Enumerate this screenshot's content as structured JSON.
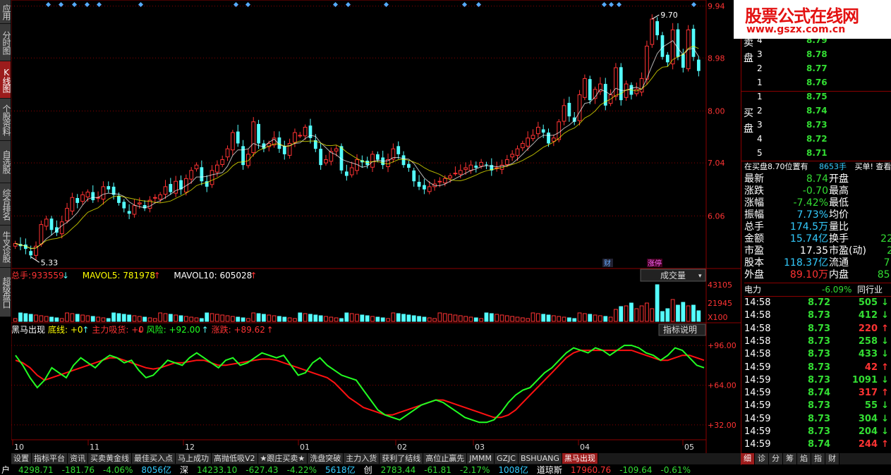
{
  "left_nav": [
    "应用",
    "分时图",
    "K线图",
    "个股资料",
    "自选股",
    "综合排名",
    "牛叉诊股",
    "超级盘口"
  ],
  "left_nav_active": 2,
  "price_axis": [
    "9.94",
    "8.98",
    "8.00",
    "7.04",
    "6.06"
  ],
  "price_annotations": {
    "high": "9.70",
    "low": "5.33"
  },
  "event_labels": {
    "fin": "财",
    "limit": "涨停"
  },
  "volume_header": {
    "total_label": "总手",
    "total_value": "933559",
    "ma5_label": "MAVOL5",
    "ma5_value": "781978",
    "ma10_label": "MAVOL10",
    "ma10_value": "605028",
    "selector": "成交量"
  },
  "volume_axis": [
    "43105",
    "21945"
  ],
  "volume_unit": "X100",
  "indicator_header": {
    "name": "黑马出现",
    "items": [
      {
        "label": "底线",
        "value": "+0"
      },
      {
        "label": "主力吸货",
        "value": "+0"
      },
      {
        "label": "风险",
        "value": "+92.00"
      },
      {
        "label": "涨跌",
        "value": "+89.62"
      }
    ],
    "explain_button": "指标说明"
  },
  "indicator_axis": [
    "+96.00",
    "+64.00",
    "+32.00"
  ],
  "date_axis": [
    "10",
    "11",
    "12",
    "01",
    "02",
    "03",
    "04",
    "05"
  ],
  "bottom_tabs": [
    "设置",
    "指标平台",
    "资讯",
    "买卖黄金线",
    "最佳买入点",
    "马上成功",
    "高抛低吸V2",
    "★跟庄买卖★",
    "洗盘突破",
    "主力入货",
    "获利了结线",
    "高位止赢先",
    "JMMM",
    "GZJC",
    "BSHUANG",
    "黑马出现"
  ],
  "bottom_tab_active": 15,
  "logo": {
    "title": "股票公式在线网",
    "url": "www.gszx.com.cn"
  },
  "order_book": {
    "sell_label": "卖盘",
    "buy_label": "买盘",
    "sell": [
      {
        "level": "4",
        "price": "8.79"
      },
      {
        "level": "3",
        "price": "8.78"
      },
      {
        "level": "2",
        "price": "8.77"
      },
      {
        "level": "1",
        "price": "8.76"
      }
    ],
    "buy": [
      {
        "level": "1",
        "price": "8.75"
      },
      {
        "level": "2",
        "price": "8.74"
      },
      {
        "level": "3",
        "price": "8.73"
      },
      {
        "level": "4",
        "price": "8.72"
      },
      {
        "level": "5",
        "price": "8.71"
      }
    ],
    "notice": "在买盘8.70位置有",
    "notice_value": "8653手",
    "notice_tail": "买单! 查看"
  },
  "quote": [
    {
      "l": "最新",
      "v": "8.74",
      "c": "#33dd33",
      "l2": "开盘",
      "v2": ""
    },
    {
      "l": "涨跌",
      "v": "-0.70",
      "c": "#33dd33",
      "l2": "最高",
      "v2": ""
    },
    {
      "l": "涨幅",
      "v": "-7.42%",
      "c": "#33dd33",
      "l2": "最低",
      "v2": ""
    },
    {
      "l": "振幅",
      "v": "7.73%",
      "c": "#33ccff",
      "l2": "均价",
      "v2": ""
    },
    {
      "l": "总手",
      "v": "174.5万",
      "c": "#33ccff",
      "l2": "量比",
      "v2": ""
    },
    {
      "l": "金额",
      "v": "15.74亿",
      "c": "#33ccff",
      "l2": "换手",
      "v2": "22"
    },
    {
      "l": "市盈",
      "v": "17.35",
      "c": "#ffffff",
      "l2": "市盈(动)",
      "v2": "2"
    },
    {
      "l": "股本",
      "v": "118.37亿",
      "c": "#33ccff",
      "l2": "流通",
      "v2": "7."
    },
    {
      "l": "外盘",
      "v": "89.10万",
      "c": "#ff3333",
      "l2": "内盘",
      "v2": "85."
    }
  ],
  "sector": {
    "name": "电力",
    "change": "-6.09%",
    "compare": "同行业"
  },
  "ticks": [
    {
      "time": "14:58",
      "price": "8.72",
      "vol": "505",
      "dir": "down"
    },
    {
      "time": "14:58",
      "price": "8.73",
      "vol": "412",
      "dir": "down"
    },
    {
      "time": "14:58",
      "price": "8.73",
      "vol": "220",
      "dir": "up"
    },
    {
      "time": "14:58",
      "price": "8.73",
      "vol": "258",
      "dir": "down"
    },
    {
      "time": "14:58",
      "price": "8.73",
      "vol": "433",
      "dir": "down"
    },
    {
      "time": "14:59",
      "price": "8.73",
      "vol": "42",
      "dir": "up"
    },
    {
      "time": "14:59",
      "price": "8.73",
      "vol": "1091",
      "dir": "down"
    },
    {
      "time": "14:59",
      "price": "8.74",
      "vol": "317",
      "dir": "up"
    },
    {
      "time": "14:59",
      "price": "8.73",
      "vol": "55",
      "dir": "down"
    },
    {
      "time": "14:59",
      "price": "8.73",
      "vol": "304",
      "dir": "down"
    },
    {
      "time": "14:59",
      "price": "8.73",
      "vol": "204",
      "dir": "down"
    },
    {
      "time": "14:59",
      "price": "8.74",
      "vol": "244",
      "dir": "up"
    }
  ],
  "right_tabs": [
    "细",
    "诊",
    "分",
    "筹",
    "焰",
    "指",
    "财"
  ],
  "right_tab_active": 0,
  "status_bar": [
    {
      "text": "户",
      "c": "#ffffff"
    },
    {
      "text": "4298.71",
      "c": "#33dd33"
    },
    {
      "text": "-181.76",
      "c": "#33dd33"
    },
    {
      "text": "-4.06%",
      "c": "#33dd33"
    },
    {
      "text": "8056亿",
      "c": "#33ccff"
    },
    {
      "text": "深",
      "c": "#ffffff"
    },
    {
      "text": "14233.10",
      "c": "#33dd33"
    },
    {
      "text": "-627.43",
      "c": "#33dd33"
    },
    {
      "text": "-4.22%",
      "c": "#33dd33"
    },
    {
      "text": "5618亿",
      "c": "#33ccff"
    },
    {
      "text": "创",
      "c": "#ffffff"
    },
    {
      "text": "2783.44",
      "c": "#33dd33"
    },
    {
      "text": "-61.81",
      "c": "#33dd33"
    },
    {
      "text": "-2.17%",
      "c": "#33dd33"
    },
    {
      "text": "1008亿",
      "c": "#33ccff"
    },
    {
      "text": "道琼斯",
      "c": "#ffffff"
    },
    {
      "text": "17960.76",
      "c": "#ff3333"
    },
    {
      "text": "-109.64",
      "c": "#33dd33"
    },
    {
      "text": "-0.61%",
      "c": "#33dd33"
    }
  ],
  "colors": {
    "up": "#ff3333",
    "down": "#54ffff",
    "ma_white": "#ffffff",
    "ma_yellow": "#ffff00",
    "grid": "#8b0000",
    "indicator_green": "#22ff22",
    "indicator_red": "#ff1111"
  },
  "chart_data": {
    "type": "candlestick",
    "price_range": [
      5.33,
      9.94
    ],
    "labeled_high": 9.7,
    "labeled_low": 5.33,
    "close_series": [
      5.55,
      5.5,
      5.45,
      5.33,
      5.5,
      5.9,
      6.0,
      5.8,
      5.75,
      5.95,
      6.2,
      6.4,
      6.3,
      6.45,
      6.5,
      6.35,
      6.4,
      6.6,
      6.55,
      6.45,
      6.3,
      6.2,
      6.1,
      6.25,
      6.3,
      6.2,
      6.35,
      6.4,
      6.45,
      6.6,
      6.5,
      6.7,
      6.55,
      6.75,
      6.9,
      7.0,
      6.7,
      6.6,
      6.9,
      7.0,
      7.1,
      7.3,
      7.6,
      7.4,
      7.0,
      7.2,
      7.8,
      7.4,
      7.3,
      7.4,
      7.5,
      7.3,
      7.2,
      7.4,
      7.6,
      7.55,
      7.7,
      7.5,
      7.3,
      7.0,
      7.1,
      7.25,
      7.3,
      6.9,
      6.8,
      6.95,
      7.1,
      7.05,
      7.0,
      7.2,
      7.1,
      7.0,
      7.1,
      7.3,
      7.2,
      7.0,
      6.95,
      6.7,
      6.6,
      6.55,
      6.6,
      6.65,
      6.7,
      6.75,
      6.8,
      6.85,
      6.9,
      6.95,
      7.0,
      6.95,
      7.05,
      7.0,
      6.9,
      6.95,
      7.0,
      7.1,
      7.2,
      7.3,
      7.4,
      7.5,
      7.55,
      7.7,
      7.6,
      7.4,
      7.5,
      7.8,
      8.1,
      7.9,
      7.8,
      8.3,
      8.6,
      8.2,
      8.4,
      8.5,
      8.1,
      8.3,
      8.8,
      8.2,
      8.5,
      8.3,
      8.4,
      8.6,
      9.2,
      9.7,
      9.4,
      9.0,
      8.9,
      9.5,
      9.0,
      8.8,
      9.5,
      9.0,
      8.74
    ],
    "indicator_series": {
      "green": [
        88,
        80,
        70,
        62,
        68,
        78,
        74,
        70,
        80,
        86,
        82,
        78,
        84,
        88,
        86,
        82,
        84,
        76,
        70,
        72,
        78,
        84,
        82,
        80,
        86,
        90,
        86,
        82,
        78,
        84,
        86,
        80,
        82,
        86,
        90,
        88,
        86,
        88,
        80,
        72,
        74,
        82,
        86,
        80,
        76,
        72,
        70,
        68,
        60,
        52,
        44,
        40,
        38,
        36,
        40,
        44,
        48,
        50,
        52,
        50,
        46,
        42,
        38,
        36,
        34,
        34,
        36,
        42,
        50,
        56,
        60,
        62,
        68,
        74,
        78,
        84,
        90,
        94,
        92,
        90,
        94,
        92,
        88,
        92,
        96,
        96,
        94,
        90,
        88,
        84,
        88,
        94,
        92,
        86,
        80,
        78
      ],
      "red": [
        84,
        82,
        78,
        72,
        68,
        70,
        72,
        74,
        76,
        78,
        80,
        82,
        84,
        86,
        86,
        84,
        82,
        80,
        78,
        77,
        78,
        80,
        82,
        82,
        83,
        84,
        84,
        82,
        80,
        80,
        81,
        82,
        83,
        84,
        85,
        85,
        84,
        82,
        80,
        78,
        76,
        74,
        72,
        70,
        66,
        60,
        54,
        50,
        46,
        44,
        42,
        40,
        40,
        42,
        44,
        46,
        48,
        50,
        52,
        52,
        50,
        48,
        46,
        44,
        42,
        40,
        38,
        38,
        40,
        44,
        50,
        56,
        62,
        68,
        74,
        80,
        86,
        90,
        92,
        92,
        92,
        92,
        92,
        92,
        92,
        92,
        90,
        88,
        86,
        84,
        84,
        86,
        88,
        88,
        86,
        84
      ]
    }
  }
}
